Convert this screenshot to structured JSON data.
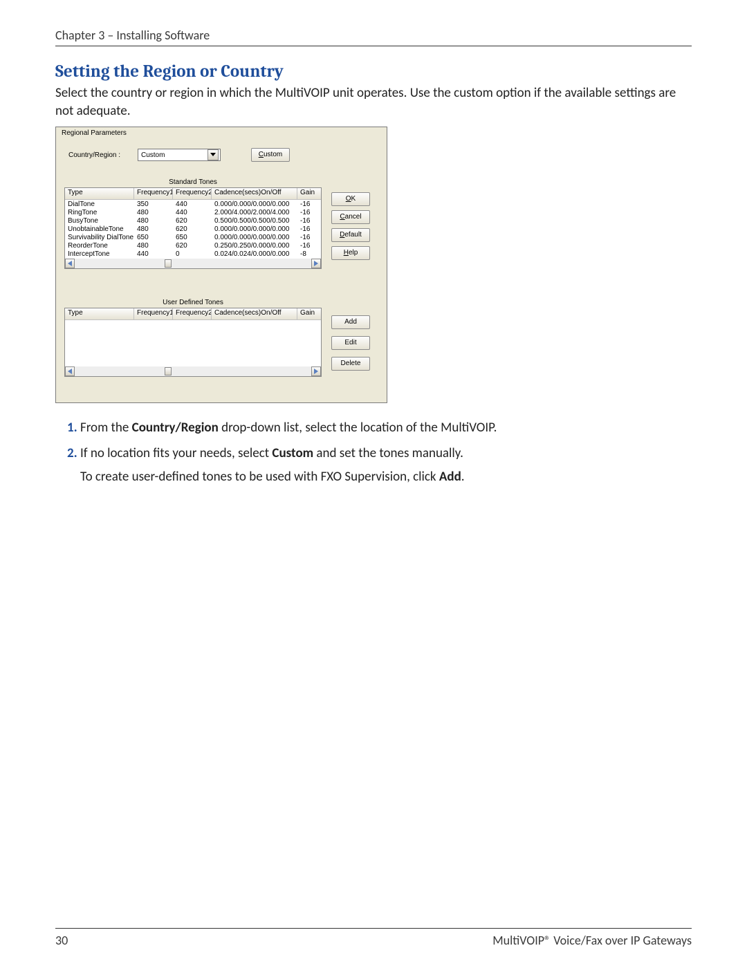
{
  "header": {
    "chapter": "Chapter 3 – Installing Software"
  },
  "section": {
    "title": "Setting the Region or Country",
    "intro": "Select the country or region in which the MultiVOIP unit operates. Use the custom option if the available settings are not adequate."
  },
  "dialog": {
    "fieldset_label": "Regional Parameters",
    "country_label": "Country/Region :",
    "country_value": "Custom",
    "custom_btn": "Custom",
    "standard_label": "Standard Tones",
    "user_label": "User Defined Tones",
    "columns": {
      "type": "Type",
      "f1": "Frequency1",
      "f2": "Frequency2",
      "cadence": "Cadence(secs)On/Off",
      "gain": "Gain"
    },
    "standard_rows": [
      {
        "type": "DialTone",
        "f1": "350",
        "f2": "440",
        "cadence": "0.000/0.000/0.000/0.000",
        "gain": "-16"
      },
      {
        "type": "RingTone",
        "f1": "480",
        "f2": "440",
        "cadence": "2.000/4.000/2.000/4.000",
        "gain": "-16"
      },
      {
        "type": "BusyTone",
        "f1": "480",
        "f2": "620",
        "cadence": "0.500/0.500/0.500/0.500",
        "gain": "-16"
      },
      {
        "type": "UnobtainableTone",
        "f1": "480",
        "f2": "620",
        "cadence": "0.000/0.000/0.000/0.000",
        "gain": "-16"
      },
      {
        "type": "Survivability DialTone",
        "f1": "650",
        "f2": "650",
        "cadence": "0.000/0.000/0.000/0.000",
        "gain": "-16"
      },
      {
        "type": "ReorderTone",
        "f1": "480",
        "f2": "620",
        "cadence": "0.250/0.250/0.000/0.000",
        "gain": "-16"
      },
      {
        "type": "InterceptTone",
        "f1": "440",
        "f2": "0",
        "cadence": "0.024/0.024/0.000/0.000",
        "gain": "-8"
      }
    ],
    "user_rows": [],
    "buttons": {
      "ok": "OK",
      "cancel": "Cancel",
      "default": "Default",
      "help": "Help",
      "add": "Add",
      "edit": "Edit",
      "delete": "Delete"
    }
  },
  "steps": {
    "s1_pre": "From the ",
    "s1_bold": "Country/Region",
    "s1_post": " drop-down list, select the location of the MultiVOIP.",
    "s2_pre": "If no location fits your needs, select ",
    "s2_bold": "Custom",
    "s2_post": " and set the tones manually.",
    "s2_sub_pre": "To create user-defined tones to be used with FXO Supervision, click ",
    "s2_sub_bold": "Add",
    "s2_sub_post": "."
  },
  "footer": {
    "page": "30",
    "product": "MultiVOIP® Voice/Fax over IP Gateways"
  }
}
